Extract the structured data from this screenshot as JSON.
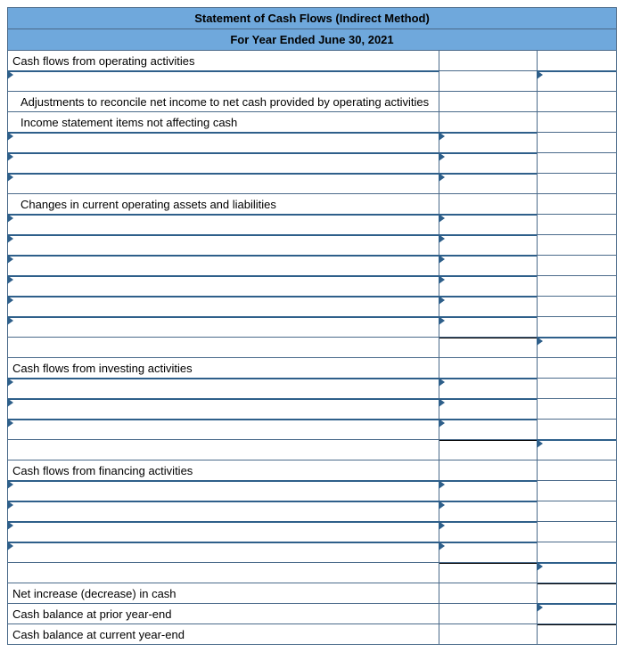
{
  "title": "Statement of Cash Flows (Indirect Method)",
  "period": "For Year Ended June 30, 2021",
  "sections": {
    "operating_header": "Cash flows from operating activities",
    "adjustments": "Adjustments to reconcile net income to net cash provided by operating activities",
    "income_items": "Income statement items not affecting cash",
    "changes_current": "Changes in current operating assets and liabilities",
    "investing_header": "Cash flows from investing activities",
    "financing_header": "Cash flows from financing activities",
    "net_increase": "Net increase (decrease) in cash",
    "prior_balance": "Cash balance at prior year-end",
    "current_balance": "Cash balance at current year-end"
  }
}
